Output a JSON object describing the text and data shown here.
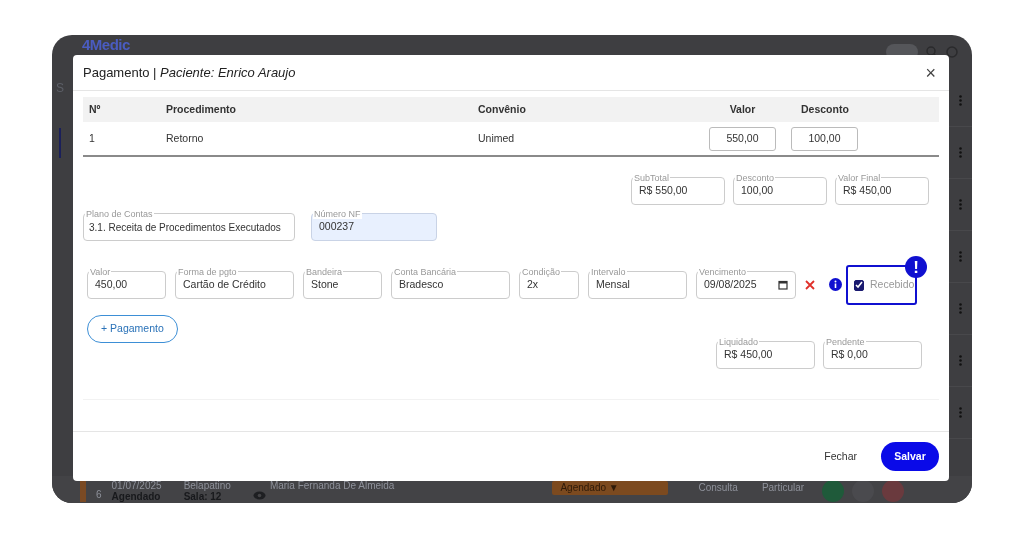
{
  "backdrop": {
    "logo": "4Medic",
    "section_fragment": "S",
    "toggle": {
      "on": false
    },
    "appointment": {
      "number": "6",
      "date": "01/07/2025",
      "status": "Agendado",
      "professional": "Belapatino",
      "room": "Sala: 12",
      "patient": "Maria Fernanda De Almeida",
      "status_select": "Agendado ▼",
      "type": "Consulta",
      "insurance": "Particular"
    }
  },
  "modal": {
    "title": "Pagamento | *Paciente: Enrico Araujo*",
    "close": "×",
    "table": {
      "columns": [
        "Nº",
        "Procedimento",
        "Convênio",
        "Valor",
        "Desconto"
      ],
      "rows": [
        {
          "number": "1",
          "procedure": "Retorno",
          "insurance": "Unimed",
          "value": "550,00",
          "discount": "100,00"
        }
      ]
    },
    "totals": [
      {
        "label": "SubTotal",
        "value": "R$ 550,00"
      },
      {
        "label": "Desconto",
        "value": "100,00"
      },
      {
        "label": "Valor Final",
        "value": "R$ 450,00"
      }
    ],
    "account": {
      "label": "Plano de Contas",
      "value": "3.1. Receita de Procedimentos Executados",
      "highlighted": false
    },
    "invoice": {
      "label": "Número NF",
      "value": "000237",
      "highlighted": true
    },
    "payments": [
      {
        "fields": [
          {
            "label": "Valor",
            "value": "450,00",
            "kind": "text"
          },
          {
            "label": "Forma de pgto",
            "value": "Cartão de Crédito",
            "kind": "text"
          },
          {
            "label": "Bandeira",
            "value": "Stone",
            "kind": "text"
          },
          {
            "label": "Conta Bancária",
            "value": "Bradesco",
            "kind": "text"
          },
          {
            "label": "Condição",
            "value": "2x",
            "kind": "text"
          },
          {
            "label": "Intervalo",
            "value": "Mensal",
            "kind": "text"
          },
          {
            "label": "Vencimento",
            "value": "09/08/2025",
            "kind": "date"
          }
        ],
        "received": {
          "label": "Recebido",
          "checked": true,
          "alert": "!"
        }
      }
    ],
    "add_payment": "+ Pagamento",
    "summary": [
      {
        "label": "Liquidado",
        "value": "R$ 450,00"
      },
      {
        "label": "Pendente",
        "value": "R$ 0,00"
      }
    ],
    "buttons": [
      {
        "label": "Fechar",
        "kind": "link"
      },
      {
        "label": "Salvar",
        "kind": "primary"
      }
    ]
  }
}
